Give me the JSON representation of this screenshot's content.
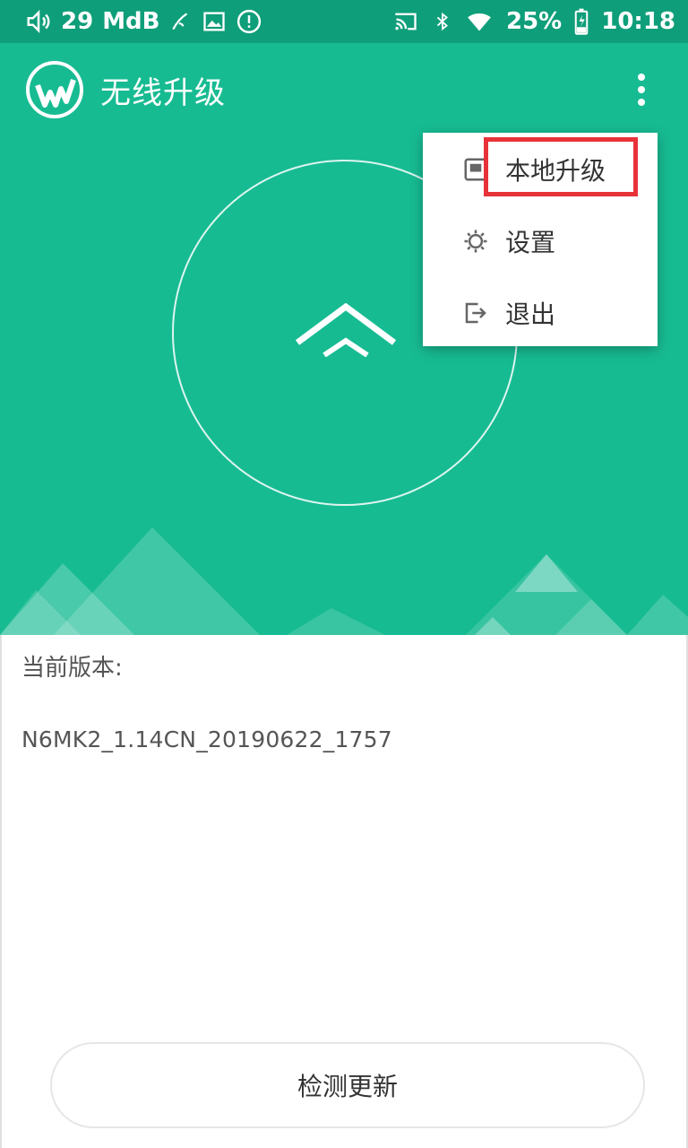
{
  "status_bar": {
    "volume_level": "29",
    "unit": "MdB",
    "battery": "25%",
    "time": "10:18",
    "icons": [
      "volume-icon",
      "pen-icon",
      "image-icon",
      "alert-icon",
      "cast-icon",
      "bluetooth-icon",
      "wifi-icon",
      "battery-charging-icon"
    ]
  },
  "toolbar": {
    "title": "无线升级",
    "logo_icon": "app-logo-icon",
    "more_icon": "more-vert-icon"
  },
  "menu": {
    "items": [
      {
        "label": "本地升级",
        "icon": "local-storage-icon"
      },
      {
        "label": "设置",
        "icon": "gear-icon"
      },
      {
        "label": "退出",
        "icon": "exit-icon"
      }
    ]
  },
  "version": {
    "label": "当前版本:",
    "value": "N6MK2_1.14CN_20190622_1757"
  },
  "actions": {
    "check_update": "检测更新"
  },
  "colors": {
    "status_bar": "#0f9e7a",
    "hero": "#17bb92",
    "highlight": "#e8323a"
  }
}
